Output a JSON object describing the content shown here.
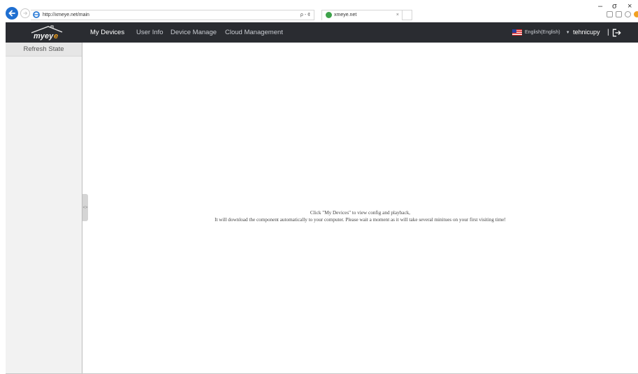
{
  "browser": {
    "url": "http://xmeye.net/main",
    "search_glyph": "ρ - ¢",
    "tab_title": "xmeye.net",
    "tab_close": "×",
    "window_controls": {
      "minimize": "–",
      "maximize": "σ",
      "close": "×"
    }
  },
  "header": {
    "nav_items": [
      {
        "label": "My Devices",
        "active": true
      },
      {
        "label": "User Info",
        "active": false
      },
      {
        "label": "Device Manage",
        "active": false
      },
      {
        "label": "Cloud Management",
        "active": false
      }
    ],
    "language": "English(English)",
    "username": "tehnicupy",
    "separator": "|"
  },
  "sidebar": {
    "refresh_label": "Refresh State",
    "collapse_glyph": "<>"
  },
  "main": {
    "message_line1": "Click \"My Devices\" to view config and playback,",
    "message_line2": "It will download the component automatically to your computer. Please wait a moment as it will take several minitues on your first visiting time!"
  },
  "colors": {
    "navbar_bg": "#2a2c31",
    "sidebar_bg": "#f2f2f2",
    "logo_accent": "#f0a020"
  }
}
